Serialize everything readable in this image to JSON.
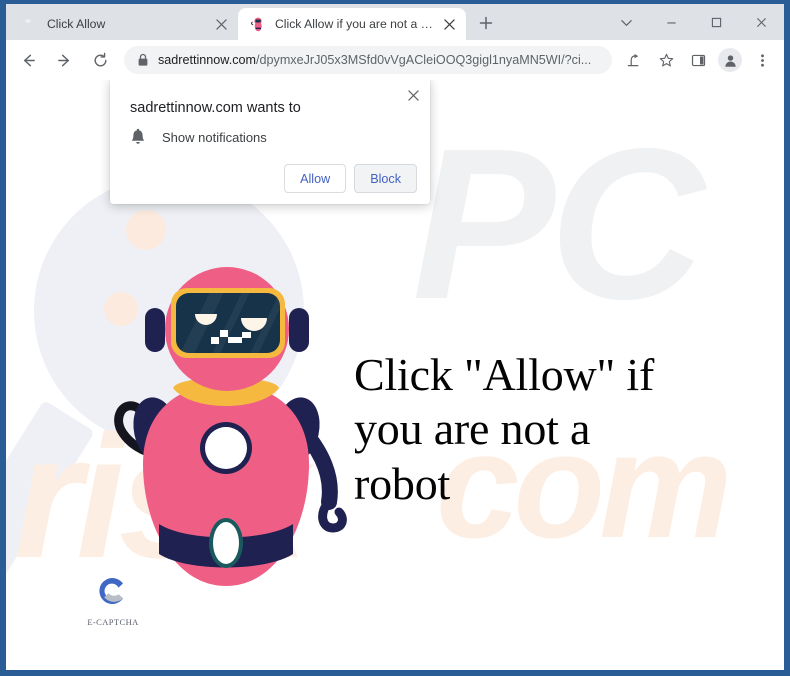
{
  "window": {
    "border_color": "#2a5d96",
    "controls": [
      {
        "name": "tab-search",
        "icon": "chevron-down-icon"
      },
      {
        "name": "minimize",
        "icon": "minimize-icon"
      },
      {
        "name": "maximize",
        "icon": "maximize-icon"
      },
      {
        "name": "close",
        "icon": "close-icon"
      }
    ]
  },
  "tabs": [
    {
      "title": "Click Allow",
      "favicon": "red-circle-icon",
      "active": false
    },
    {
      "title": "Click Allow if you are not a robot",
      "favicon": "pink-robot-icon",
      "active": true
    }
  ],
  "new_tab_label": "+",
  "toolbar": {
    "back": "back-arrow-icon",
    "forward": "forward-arrow-icon",
    "reload": "reload-icon",
    "lock": "lock-icon",
    "url_domain": "sadrettinnow.com",
    "url_path": "/dpymxeJrJ05x3MSfd0vVgACleiOOQ3gigl1nyaMN5WI/?ci...",
    "share": "share-icon",
    "bookmark": "star-icon",
    "side_panel": "side-panel-icon",
    "profile": "profile-avatar-icon",
    "menu": "three-dot-menu-icon"
  },
  "notification_dialog": {
    "title": "sadrettinnow.com wants to",
    "permission": "Show notifications",
    "permission_icon": "bell-icon",
    "close_icon": "close-icon",
    "allow_label": "Allow",
    "block_label": "Block",
    "focused_button": "Block",
    "accent_color": "#4361c2"
  },
  "page": {
    "headline": "Click \"Allow\" if you are not a robot",
    "captcha_label": "E-CAPTCHA",
    "captcha_icon": "e-captcha-c-logo",
    "robot_icon": "pink-robot-illustration",
    "watermark": {
      "text_primary": "PC",
      "text_secondary": "risk",
      "text_tertiary": "com",
      "gray": "#f0f1f3",
      "peach": "#fdeee3",
      "glass": "#eef0f5"
    },
    "colors": {
      "robot_body": "#ef5f85",
      "robot_dark": "#1f2150",
      "robot_trim": "#f6b93f",
      "visor": "#173349",
      "captcha_blue": "#3f68c5",
      "captcha_gray": "#b9bdc6"
    }
  }
}
